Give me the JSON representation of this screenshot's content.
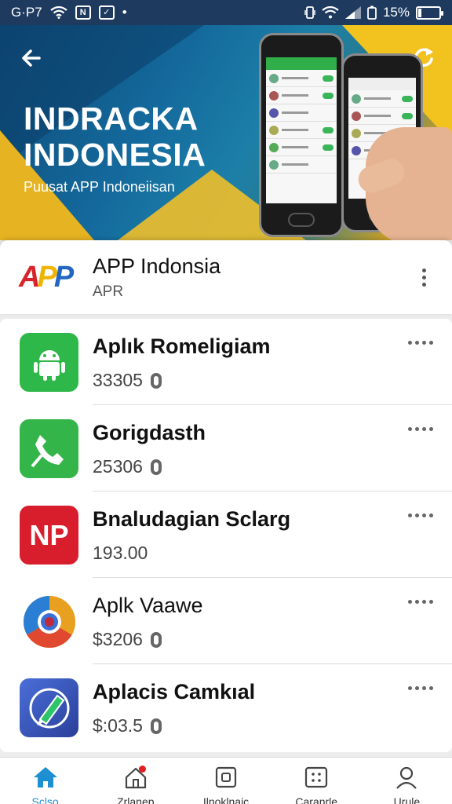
{
  "status_bar": {
    "carrier": "G·P7",
    "battery_pct_text": "15%",
    "battery_level": 0.15
  },
  "banner": {
    "title_line1": "INDRACKA",
    "title_line2": "INDONESIA",
    "subtitle": "Puusat APP Indoneiisan"
  },
  "featured": {
    "logo_text": "APP",
    "name": "APP Indonsia",
    "subtitle": "APR"
  },
  "apps": [
    {
      "name": "Aplık Romeligiam",
      "meta": "33305",
      "icon": "android-icon",
      "has_zero": true
    },
    {
      "name": "Gorigdasth",
      "meta": "25306",
      "icon": "phone-icon",
      "has_zero": true
    },
    {
      "name": "Bnaludagian Sclarg",
      "meta": "193.00",
      "icon": "np-icon",
      "icon_text": "NP",
      "has_zero": false
    },
    {
      "name": "Aplk Vaawe",
      "meta": "$3206",
      "icon": "chrome-icon",
      "has_zero": true
    },
    {
      "name": "Aplacis Camkıal",
      "meta": "$:03.5",
      "icon": "pen-icon",
      "has_zero": true
    }
  ],
  "bottom_nav": [
    {
      "label": "Sclso",
      "icon": "home-icon",
      "active": true
    },
    {
      "label": "Zrlanep",
      "icon": "house-icon",
      "badge": true
    },
    {
      "label": "Ilnoklnaic",
      "icon": "square-icon"
    },
    {
      "label": "Caranrle",
      "icon": "apps-icon"
    },
    {
      "label": "Urule",
      "icon": "profile-icon"
    }
  ],
  "colors": {
    "accent": "#1e8fd0",
    "status_bar": "#1e3a5f",
    "badge": "#e02020"
  }
}
